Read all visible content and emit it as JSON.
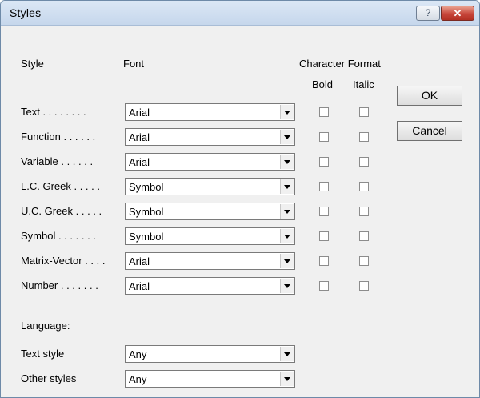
{
  "window": {
    "title": "Styles",
    "help_label": "?",
    "close_label": "✕"
  },
  "headers": {
    "style": "Style",
    "font": "Font",
    "character_format": "Character Format",
    "bold": "Bold",
    "italic": "Italic"
  },
  "rows": [
    {
      "label": "Text . . . . . . . .",
      "font": "Arial",
      "bold": false,
      "italic": false
    },
    {
      "label": "Function . . . . . .",
      "font": "Arial",
      "bold": false,
      "italic": false
    },
    {
      "label": "Variable . . . . . .",
      "font": "Arial",
      "bold": false,
      "italic": false
    },
    {
      "label": "L.C. Greek . . . . .",
      "font": "Symbol",
      "bold": false,
      "italic": false
    },
    {
      "label": "U.C. Greek . . . . .",
      "font": "Symbol",
      "bold": false,
      "italic": false
    },
    {
      "label": "Symbol . . . . . . .",
      "font": "Symbol",
      "bold": false,
      "italic": false
    },
    {
      "label": "Matrix-Vector . . . .",
      "font": "Arial",
      "bold": false,
      "italic": false
    },
    {
      "label": "Number . . . . . . .",
      "font": "Arial",
      "bold": false,
      "italic": false
    }
  ],
  "language": {
    "heading": "Language:",
    "text_style_label": "Text style",
    "text_style_value": "Any",
    "other_styles_label": "Other styles",
    "other_styles_value": "Any"
  },
  "buttons": {
    "ok": "OK",
    "cancel": "Cancel"
  }
}
